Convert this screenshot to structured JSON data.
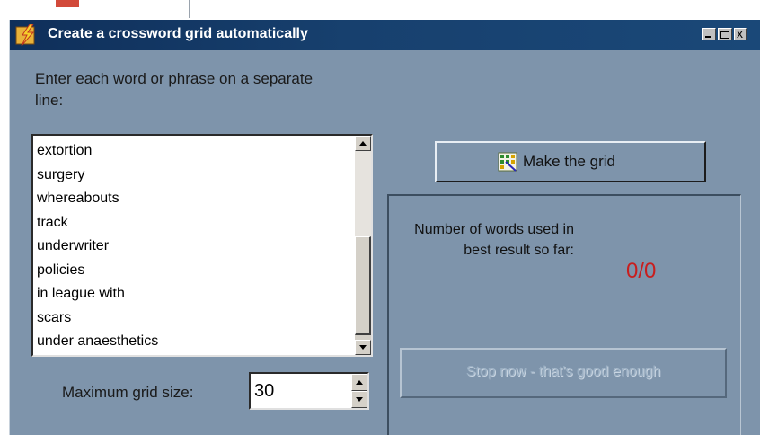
{
  "window": {
    "title": "Create a crossword grid automatically",
    "controls": [
      "minimize-icon",
      "maximize-icon",
      "close-icon"
    ],
    "close_glyph": "x"
  },
  "instructions": "Enter each word or phrase on a separate line:",
  "word_list": {
    "items": [
      "extortion",
      "surgery",
      "whereabouts",
      "track",
      "underwriter",
      "policies",
      "in league with",
      "scars",
      "under anaesthetics"
    ]
  },
  "grid_size": {
    "label": "Maximum grid size:",
    "value": "30"
  },
  "make_button": {
    "label": "Make the grid",
    "icon": "grid-wand-icon"
  },
  "progress": {
    "label": "Number of words used in best result so far:",
    "value": "0/0",
    "value_color": "#c81e1e"
  },
  "stop_button": {
    "label": "Stop now - that's good enough",
    "enabled": false
  },
  "colors": {
    "window_bg": "#7e94ab",
    "titlebar": "#17406e"
  }
}
